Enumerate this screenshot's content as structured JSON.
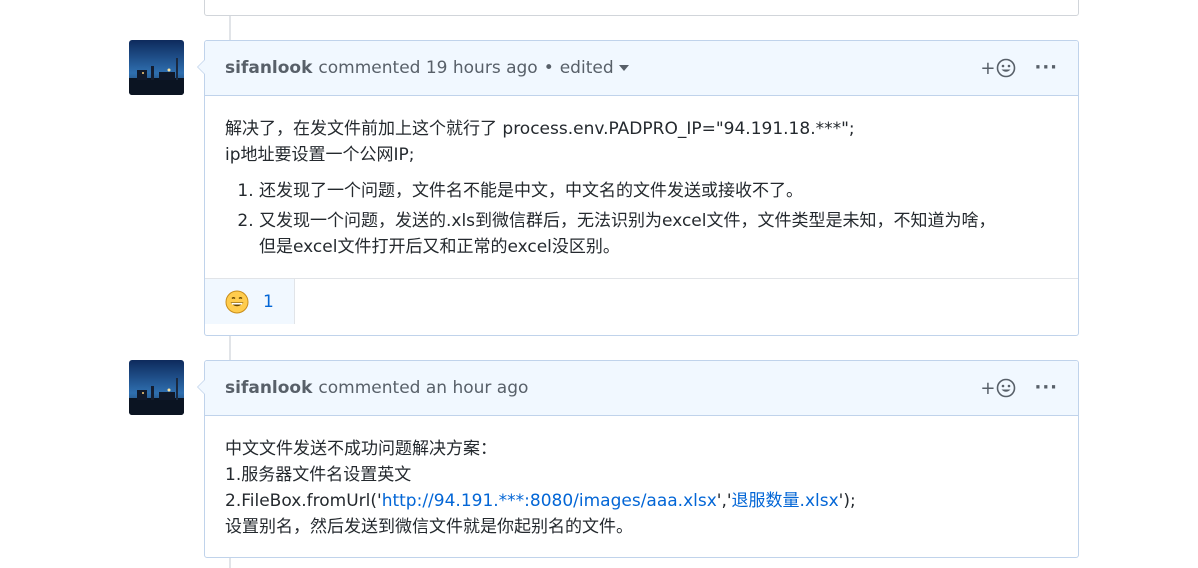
{
  "comments": [
    {
      "author": "sifanlook",
      "meta": "commented 19 hours ago",
      "separator": "•",
      "edited_label": "edited",
      "react_plus": "+",
      "more_label": "···",
      "body_lines": [
        "解决了，在发文件前加上这个就行了 process.env.PADPRO_IP=\"94.191.18.***\";",
        "ip地址要设置一个公网IP;"
      ],
      "list_items": [
        "还发现了一个问题，文件名不能是中文，中文名的文件发送或接收不了。",
        "又发现一个问题，发送的.xls到微信群后，无法识别为excel文件，文件类型是未知，不知道为啥，",
        "但是excel文件打开后又和正常的excel没区别。"
      ],
      "reaction": {
        "icon": "grinning-face-icon",
        "count": "1"
      }
    },
    {
      "author": "sifanlook",
      "meta": "commented an hour ago",
      "react_plus": "+",
      "more_label": "···",
      "line1": "中文文件发送不成功问题解决方案：",
      "line2": "1.服务器文件名设置英文",
      "line3_prefix": "2.FileBox.fromUrl('",
      "line3_url": "http://94.191.***:8080/images/aaa.xlsx",
      "line3_mid": "','",
      "line3_name": "退服数量.xlsx",
      "line3_suffix": "');",
      "line4": "设置别名，然后发送到微信文件就是你起别名的文件。"
    }
  ],
  "colors": {
    "header_bg": "#f1f8ff",
    "border": "#c0d3eb",
    "link": "#0366d6",
    "text": "#24292e",
    "meta": "#586069"
  }
}
